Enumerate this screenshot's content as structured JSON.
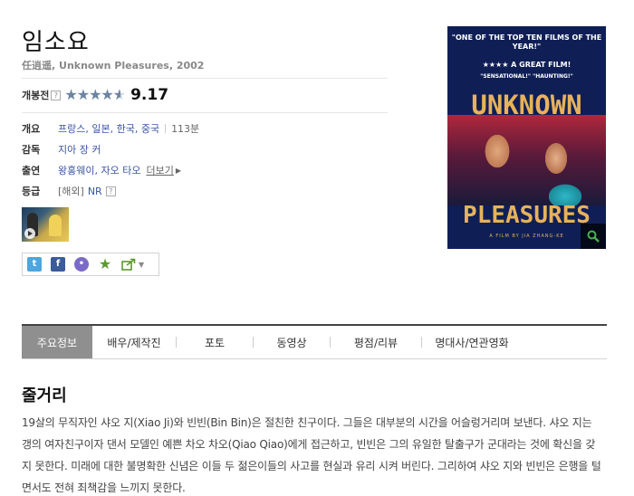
{
  "movie": {
    "title": "임소요",
    "subtitle": "任逍遥, Unknown Pleasures, 2002"
  },
  "rating": {
    "label": "개봉전",
    "help": "?",
    "score": "9.17",
    "fraction": 0.917
  },
  "info": {
    "overview_label": "개요",
    "countries": "프랑스, 일본, 한국, 중국",
    "runtime": "113분",
    "director_label": "감독",
    "director": "지아 장 커",
    "cast_label": "출연",
    "cast": "왕홍웨이, 자오 타오",
    "cast_more": "더보기",
    "grade_label": "등급",
    "grade_region": "[해외]",
    "grade_value": "NR",
    "grade_help": "?"
  },
  "poster": {
    "quote1": "\"ONE OF THE TOP TEN FILMS OF THE YEAR!\"",
    "stars_line": "★★★★ A GREAT FILM!",
    "quote2": "\"SENSATIONAL!\"   \"HAUNTING!\"",
    "title_line1": "UNKNOWN",
    "title_line2": "PLEASURES",
    "credit": "A FILM BY JIA ZHANG-KE"
  },
  "tabs": [
    "주요정보",
    "배우/제작진",
    "포토",
    "동영상",
    "평점/리뷰",
    "명대사/연관영화"
  ],
  "synopsis": {
    "title": "줄거리",
    "text": "19살의 무직자인 샤오 지(Xiao Ji)와 빈빈(Bin Bin)은 절친한 친구이다. 그들은 대부분의 시간을 어슬렁거리며 보낸다. 샤오 지는 갱의 여자친구이자 댄서 모델인 예쁜 차오 차오(Qiao Qiao)에게 접근하고, 빈빈은 그의 유일한 탈출구가 군대라는 것에 확신을 갖지 못한다. 미래에 대한 불명확한 신념은 이들 두 젊은이들의 사고를 현실과 유리 시켜 버린다. 그리하여 샤오 지와 빈빈은 은행을 털면서도 전혀 죄책감을 느끼지 못한다."
  },
  "colors": {
    "link": "#3a55a0",
    "tab_active": "#8f8f8f",
    "poster_bg": "#0f1f56",
    "poster_text": "#e8b25a"
  }
}
